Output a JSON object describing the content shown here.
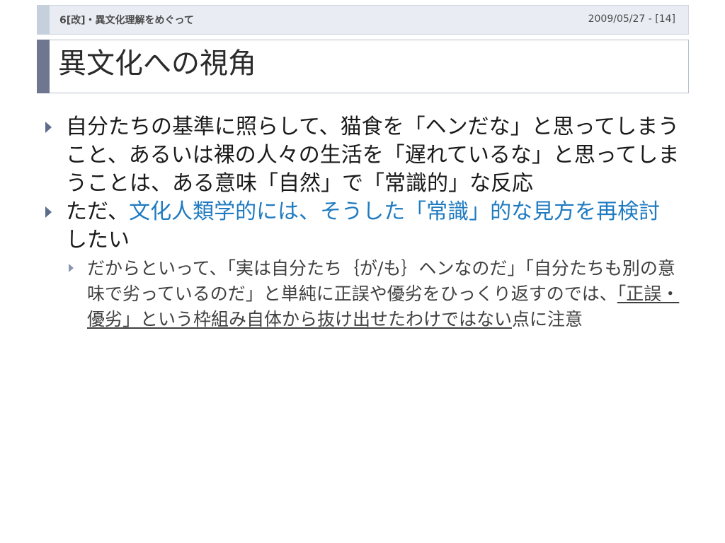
{
  "header": {
    "left_text": "6[改]・異文化理解をめぐって",
    "right_text": "2009/05/27 - [14]"
  },
  "slide": {
    "title": "異文化への視角"
  },
  "bullets": [
    {
      "text": "自分たちの基準に照らして、猫食を「ヘンだな」と思ってしまうこと、あるいは裸の人々の生活を「遅れているな」と思ってしまうことは、ある意味「自然」で「常識的」な反応"
    },
    {
      "prefix": "ただ、",
      "highlight": "文化人類学的には、そうした「常識」的な見方を再検討",
      "suffix": "したい",
      "sub": {
        "prefix": "だからといって、「実は自分たち｛が/も｝ヘンなのだ」「自分たちも別の意味で劣っているのだ」と単純に正誤や優劣をひっくり返すのでは、",
        "underlined": "「正誤・優劣」という枠組み自体から抜け出せたわけではない",
        "suffix": "点に注意"
      }
    }
  ],
  "colors": {
    "highlight": "#1f7bc1",
    "title_accent": "#6f7790",
    "header_bg": "#e9edf3"
  }
}
